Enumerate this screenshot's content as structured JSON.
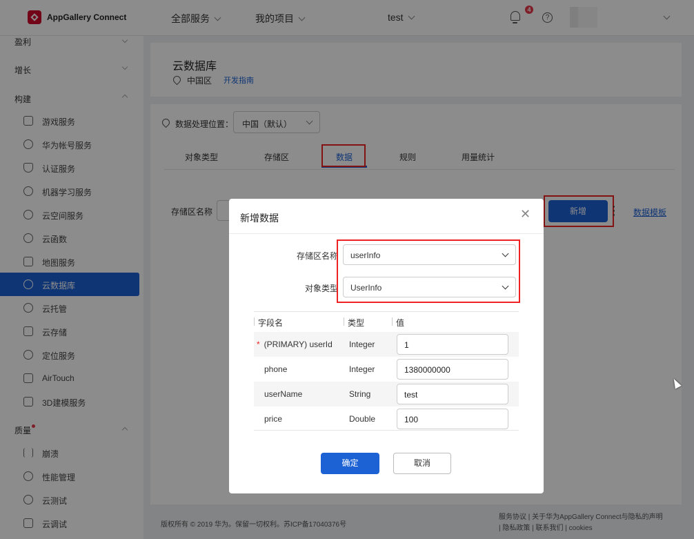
{
  "topbar": {
    "brand": "AppGallery Connect",
    "nav": [
      "全部服务",
      "我的项目",
      "test"
    ],
    "notification_count": "4",
    "help_glyph": "?"
  },
  "sidebar": {
    "sections": [
      {
        "label": "盈利"
      },
      {
        "label": "增长"
      },
      {
        "label": "构建"
      },
      {
        "label": "质量"
      }
    ],
    "build_items": [
      {
        "label": "游戏服务",
        "icon": "game-icon"
      },
      {
        "label": "华为帐号服务",
        "icon": "user-icon"
      },
      {
        "label": "认证服务",
        "icon": "shield-icon"
      },
      {
        "label": "机器学习服务",
        "icon": "ml-icon"
      },
      {
        "label": "云空间服务",
        "icon": "cloud-icon"
      },
      {
        "label": "云函数",
        "icon": "function-icon"
      },
      {
        "label": "地图服务",
        "icon": "map-icon"
      },
      {
        "label": "云数据库",
        "icon": "database-icon"
      },
      {
        "label": "云托管",
        "icon": "hosting-icon"
      },
      {
        "label": "云存储",
        "icon": "storage-icon"
      },
      {
        "label": "定位服务",
        "icon": "location-icon"
      },
      {
        "label": "AirTouch",
        "icon": "airtouch-icon"
      },
      {
        "label": "3D建模服务",
        "icon": "3d-icon"
      }
    ],
    "quality_items": [
      {
        "label": "崩溃",
        "icon": "crash-icon"
      },
      {
        "label": "性能管理",
        "icon": "performance-icon"
      },
      {
        "label": "云测试",
        "icon": "cloud-test-icon"
      },
      {
        "label": "云调试",
        "icon": "cloud-debug-icon"
      }
    ],
    "active_item": "云数据库"
  },
  "header": {
    "title": "云数据库",
    "region": "中国区",
    "guide_link": "开发指南"
  },
  "location": {
    "label": "数据处理位置：",
    "selected": "中国（默认）"
  },
  "tabs": [
    {
      "label": "对象类型"
    },
    {
      "label": "存储区"
    },
    {
      "label": "数据",
      "active": true
    },
    {
      "label": "规则"
    },
    {
      "label": "用量统计"
    }
  ],
  "toolbar": {
    "zone_label": "存储区名称",
    "add_label": "新增",
    "template_link": "数据模板"
  },
  "footer": {
    "copyright": "版权所有 © 2019 华为。保留一切权利。苏ICP备17040376号",
    "links_line1": "服务协议 | 关于华为AppGallery Connect与隐私的声明",
    "links_line2": "| 隐私政策 | 联系我们 | cookies"
  },
  "modal": {
    "title": "新增数据",
    "zone_label": "存储区名称",
    "zone_value": "userInfo",
    "type_label": "对象类型",
    "type_value": "UserInfo",
    "columns": [
      "字段名",
      "类型",
      "值"
    ],
    "rows": [
      {
        "field": "(PRIMARY) userId",
        "type": "Integer",
        "value": "1",
        "required": true
      },
      {
        "field": "phone",
        "type": "Integer",
        "value": "1380000000",
        "required": false
      },
      {
        "field": "userName",
        "type": "String",
        "value": "test",
        "required": false
      },
      {
        "field": "price",
        "type": "Double",
        "value": "100",
        "required": false
      }
    ],
    "ok_label": "确定",
    "cancel_label": "取消",
    "close_glyph": "✕",
    "required_mark": "*"
  },
  "colors": {
    "accent": "#1d62d5",
    "highlight_box": "#ee2222",
    "brand_red": "#cf0a2c"
  }
}
